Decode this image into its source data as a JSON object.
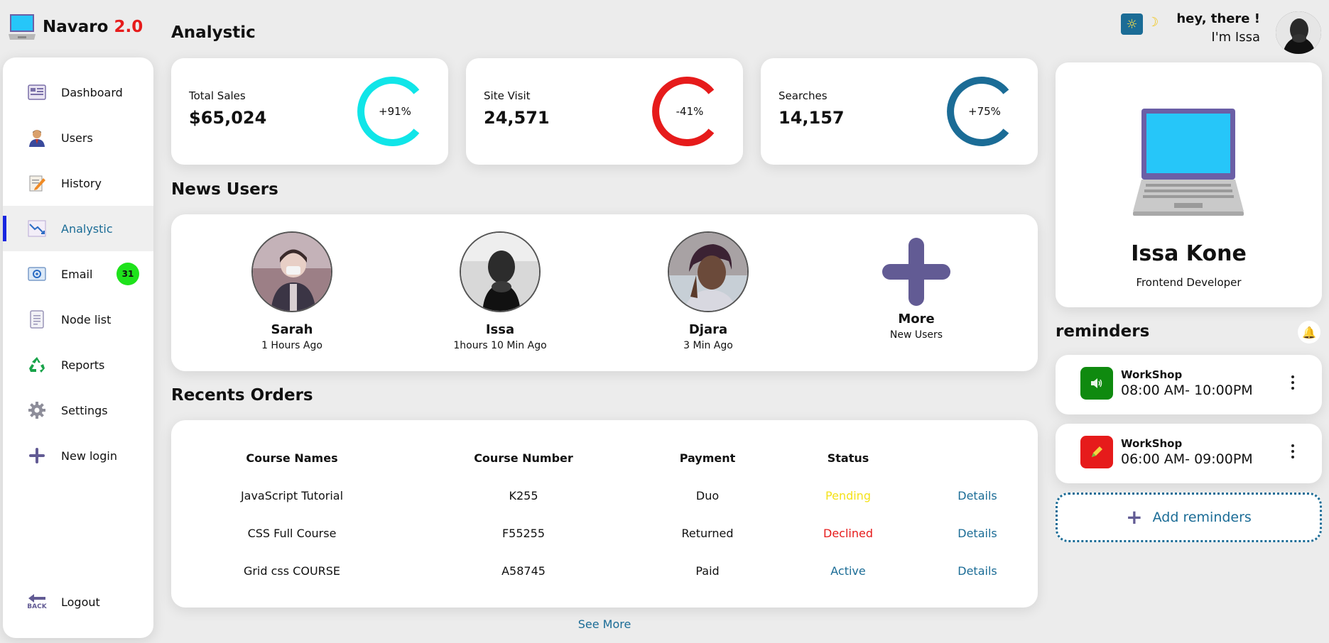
{
  "brand": {
    "name": "Navaro",
    "version": "2.0"
  },
  "sidebar": {
    "items": [
      {
        "label": "Dashboard",
        "icon": "dashboard-icon"
      },
      {
        "label": "Users",
        "icon": "user-icon"
      },
      {
        "label": "History",
        "icon": "history-icon"
      },
      {
        "label": "Analystic",
        "icon": "analytics-icon",
        "active": true
      },
      {
        "label": "Email",
        "icon": "email-icon",
        "badge": "31"
      },
      {
        "label": "Node list",
        "icon": "note-list-icon"
      },
      {
        "label": "Reports",
        "icon": "recycle-icon"
      },
      {
        "label": "Settings",
        "icon": "gear-icon"
      },
      {
        "label": "New login",
        "icon": "plus-icon"
      }
    ],
    "logout": {
      "label": "Logout",
      "icon": "back-arrow-icon",
      "icon_text": "BACK"
    }
  },
  "analytics": {
    "title": "Analystic",
    "cards": [
      {
        "label": "Total Sales",
        "value": "$65,024",
        "percent": "+91%",
        "ring_color": "#10e5e8"
      },
      {
        "label": "Site Visit",
        "value": "24,571",
        "percent": "-41%",
        "ring_color": "#e61b1b"
      },
      {
        "label": "Searches",
        "value": "14,157",
        "percent": "+75%",
        "ring_color": "#1b6c96"
      }
    ]
  },
  "new_users": {
    "title": "News Users",
    "users": [
      {
        "name": "Sarah",
        "time": "1 Hours Ago"
      },
      {
        "name": "Issa",
        "time": "1hours 10 Min Ago"
      },
      {
        "name": "Djara",
        "time": "3 Min Ago"
      }
    ],
    "more": {
      "title": "More",
      "subtitle": "New Users"
    }
  },
  "orders": {
    "title": "Recents Orders",
    "columns": [
      "Course Names",
      "Course Number",
      "Payment",
      "Status"
    ],
    "rows": [
      {
        "name": "JavaScript Tutorial",
        "number": "K255",
        "payment": "Duo",
        "status": "Pending",
        "status_color": "#f4e21a",
        "action": "Details"
      },
      {
        "name": "CSS Full Course",
        "number": "F55255",
        "payment": "Returned",
        "status": "Declined",
        "status_color": "#e61b1b",
        "action": "Details"
      },
      {
        "name": "Grid css COURSE",
        "number": "A58745",
        "payment": "Paid",
        "status": "Active",
        "status_color": "#1b6c96",
        "action": "Details"
      }
    ],
    "see_more": "See More"
  },
  "header": {
    "greeting_line1": "hey, there !",
    "greeting_line2": "I'm Issa"
  },
  "profile": {
    "name": "Issa Kone",
    "role": "Frontend Developer"
  },
  "reminders": {
    "title": "reminders",
    "items": [
      {
        "title": "WorkShop",
        "time": "08:00 AM- 10:00PM",
        "icon": "speaker-icon",
        "color": "#0f8a0f"
      },
      {
        "title": "WorkShop",
        "time": "06:00 AM- 09:00PM",
        "icon": "pencil-icon",
        "color": "#e61b1b"
      }
    ],
    "add_label": "Add reminders"
  },
  "colors": {
    "accent": "#1b6c96",
    "brand_red": "#e61b1b",
    "purple": "#625b94"
  }
}
